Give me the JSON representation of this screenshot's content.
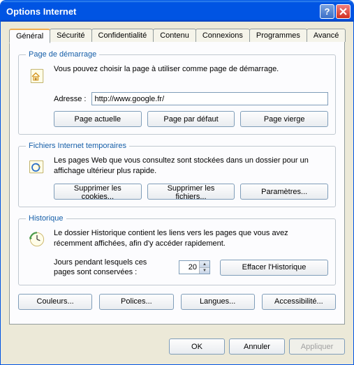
{
  "title": "Options Internet",
  "tabs": {
    "t0": "Général",
    "t1": "Sécurité",
    "t2": "Confidentialité",
    "t3": "Contenu",
    "t4": "Connexions",
    "t5": "Programmes",
    "t6": "Avancé"
  },
  "startpage": {
    "legend": "Page de démarrage",
    "desc": "Vous pouvez choisir la page à utiliser comme page de démarrage.",
    "addr_label": "Adresse :",
    "addr_value": "http://www.google.fr/",
    "btn_current": "Page actuelle",
    "btn_default": "Page par défaut",
    "btn_blank": "Page vierge"
  },
  "tempfiles": {
    "legend": "Fichiers Internet temporaires",
    "desc": "Les pages Web que vous consultez sont stockées dans un dossier pour un affichage ultérieur plus rapide.",
    "btn_cookies": "Supprimer les cookies...",
    "btn_files": "Supprimer les fichiers...",
    "btn_settings": "Paramètres..."
  },
  "history": {
    "legend": "Historique",
    "desc": "Le dossier Historique contient les liens vers les pages que vous avez récemment affichées, afin d'y accéder rapidement.",
    "days_label": "Jours pendant lesquels ces pages sont conservées :",
    "days_value": "20",
    "btn_clear": "Effacer l'Historique"
  },
  "bottom": {
    "colors": "Couleurs...",
    "fonts": "Polices...",
    "languages": "Langues...",
    "accessibility": "Accessibilité..."
  },
  "dialog": {
    "ok": "OK",
    "cancel": "Annuler",
    "apply": "Appliquer"
  }
}
